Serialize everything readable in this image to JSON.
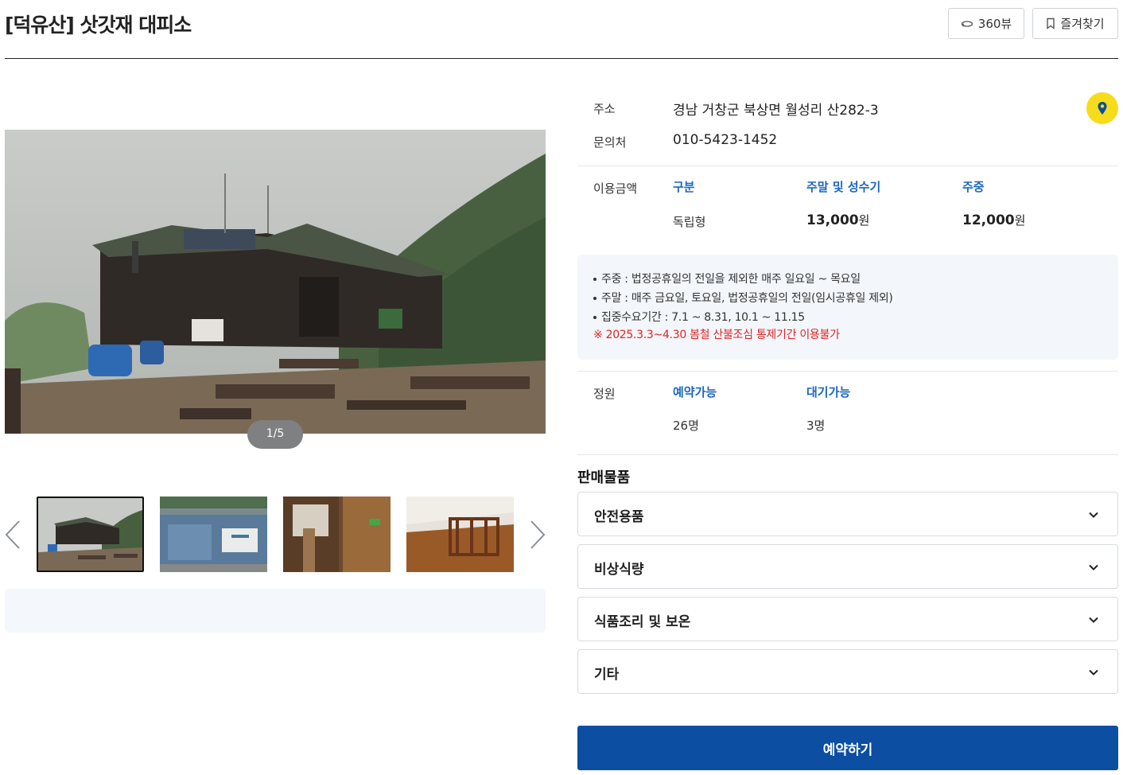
{
  "header": {
    "title": "[덕유산] 삿갓재 대피소",
    "btn_360": "360뷰",
    "btn_favorite": "즐겨찾기",
    "icons": {
      "view360": "360-view-icon",
      "favorite": "bookmark-icon"
    }
  },
  "gallery": {
    "counter": "1/5",
    "thumbnails": [
      "shelter-exterior",
      "facility-mural",
      "interior-hallway",
      "interior-wood-floor"
    ],
    "selected_thumbnail": 1
  },
  "details": {
    "address_label": "주소",
    "address": "경남 거창군 북상면 월성리 산282-3",
    "contact_label": "문의처",
    "contact": "010-5423-1452",
    "map_icon": "location-pin-icon",
    "price_label": "이용금액",
    "price_headers": [
      "구분",
      "주말 및 성수기",
      "주중"
    ],
    "price_row": {
      "type": "독립형",
      "weekend": "13,000",
      "weekday": "12,000",
      "unit": "원"
    },
    "notices": [
      "주중 : 법정공휴일의 전일을 제외한 매주 일요일 ~ 목요일",
      "주말 : 매주 금요일, 토요일, 법정공휴일의 전일(임시공휴일 제외)",
      "집중수요기간 : 7.1 ~ 8.31, 10.1 ~ 11.15"
    ],
    "warning": "※ 2025.3.3~4.30 봄철 산불조심 통제기간 이용불가",
    "capacity_label": "정원",
    "capacity_headers": [
      "예약가능",
      "대기가능"
    ],
    "capacity_values": [
      "26명",
      "3명"
    ]
  },
  "products": {
    "title": "판매물품",
    "items": [
      "안전용품",
      "비상식량",
      "식품조리 및 보온",
      "기타"
    ]
  },
  "reserve_button": "예약하기",
  "colors": {
    "accent_blue": "#1a66c4",
    "button_blue": "#0b4ea2",
    "map_yellow": "#f7dc1c",
    "warning_red": "#e02424"
  }
}
